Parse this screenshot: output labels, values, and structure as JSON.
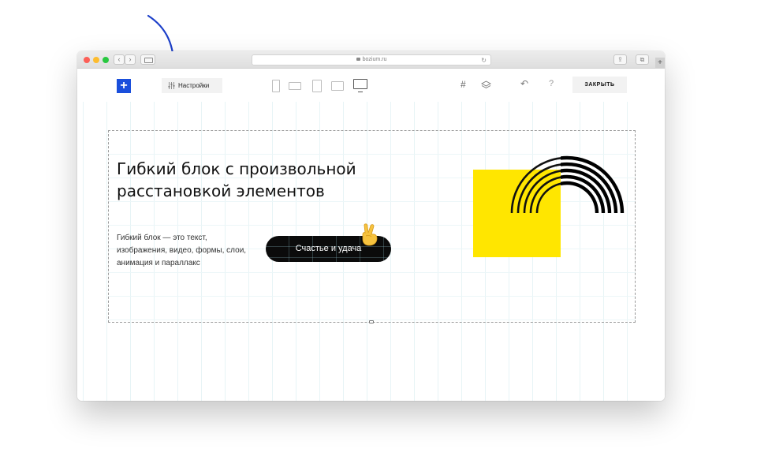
{
  "browser": {
    "url": "bozium.ru",
    "back_icon": "chevron-left-icon",
    "forward_icon": "chevron-right-icon",
    "new_tab_label": "+"
  },
  "toolbar": {
    "add_label": "+",
    "settings_label": "Настройки",
    "close_label": "ЗАКРЫТЬ",
    "help_label": "?",
    "undo_icon": "undo-icon",
    "grid_icon": "grid-icon",
    "layers_icon": "layers-icon",
    "devices": [
      "phone-portrait-icon",
      "phone-landscape-icon",
      "tablet-portrait-icon",
      "tablet-landscape-icon",
      "desktop-icon"
    ]
  },
  "block": {
    "headline_line1": "Гибкий блок с произвольной",
    "headline_line2": "расстановкой элементов",
    "desc_line1": "Гибкий блок — это текст,",
    "desc_line2": "изображения, видео, формы, слои,",
    "desc_line3": "анимация и параллакс",
    "button_label": "Счастье и удача"
  },
  "colors": {
    "accent_blue": "#1a4fdc",
    "yellow": "#ffe600",
    "button_black": "#0b0b0b",
    "arrow_blue": "#1c3fc9"
  }
}
